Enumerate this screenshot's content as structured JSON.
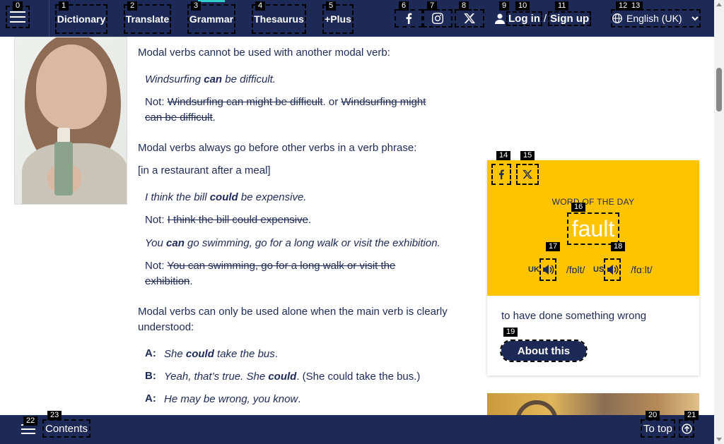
{
  "nav": {
    "items": [
      {
        "label": "Dictionary",
        "marker": "1"
      },
      {
        "label": "Translate",
        "marker": "2"
      },
      {
        "label": "Grammar",
        "marker": "3"
      },
      {
        "label": "Thesaurus",
        "marker": "4"
      },
      {
        "label": "+Plus",
        "marker": "5"
      }
    ],
    "menu_marker": "0",
    "social_markers": [
      "6",
      "7",
      "8"
    ],
    "login": {
      "icon": "user-icon",
      "login_label": "Log in",
      "separator": "/",
      "signup_label": "Sign up",
      "markers": [
        "9",
        "10",
        "11"
      ]
    },
    "language": {
      "icon": "globe-icon",
      "label": "English (UK)",
      "markers": [
        "12",
        "13"
      ]
    }
  },
  "article": {
    "p1": "Modal verbs cannot be used with another modal verb:",
    "ex1": {
      "pre": "Windsurfing ",
      "modal": "can",
      "post": " be difficult."
    },
    "not1": {
      "not": "Not: ",
      "strike_a": "Windsurfing can might be difficult",
      "or": ". or ",
      "strike_b_1": "Windsurfing might",
      "strike_b_2": "can be difficult",
      "end": "."
    },
    "p2": "Modal verbs always go before other verbs in a verb phrase:",
    "context": "[in a restaurant after a meal]",
    "ex2": {
      "pre": "I think the bill ",
      "modal": "could",
      "post": " be expensive."
    },
    "not2": {
      "not": "Not: ",
      "strike": "I think the bill could expensive",
      "end": "."
    },
    "ex3": {
      "pre": "You ",
      "modal": "can",
      "post": " go swimming, go for a long walk or visit the exhibition."
    },
    "not3": {
      "not": "Not: ",
      "strike_1": "You can swimming, go for a long walk or visit the",
      "strike_2": "exhibition",
      "end": "."
    },
    "p3_1": "Modal verbs can only be used alone when the main verb is clearly",
    "p3_2": "understood:",
    "dialogue": [
      {
        "speaker": "A:",
        "pre": "She ",
        "modal": "could",
        "post": " take the bus",
        "tail": "."
      },
      {
        "speaker": "B:",
        "pre": "Yeah, that’s true. She ",
        "modal": "could",
        "post": "",
        "tail": ". (She could take the bus.)"
      },
      {
        "speaker": "A:",
        "pre": "He may be wrong, you know",
        "modal": "",
        "post": "",
        "tail": "."
      }
    ]
  },
  "wotd": {
    "share_markers": [
      "14",
      "15"
    ],
    "label": "WORD OF THE DAY",
    "word": "fault",
    "word_marker": "16",
    "uk": {
      "region": "UK",
      "ipa": "/fɒlt/",
      "marker": "17"
    },
    "us": {
      "region": "US",
      "ipa": "/fɑːlt/",
      "marker": "18"
    },
    "definition": "to have done something wrong",
    "about_label": "About this",
    "about_marker": "19"
  },
  "bottom": {
    "contents_label": "Contents",
    "contents_marker": "23",
    "menu_marker": "22",
    "totop_label": "To top",
    "totop_marker": "20",
    "totop_icon_marker": "21"
  },
  "colors": {
    "brand": "#1d2a57",
    "accent": "#fec400",
    "active": "#33cccc"
  }
}
